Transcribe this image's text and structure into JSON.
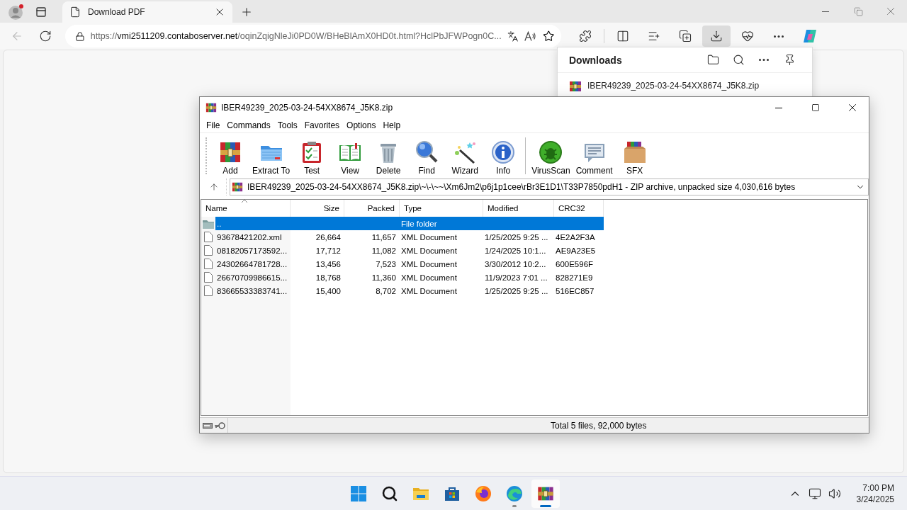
{
  "browser": {
    "tabs": [
      {
        "title": "Download PDF",
        "selected": true
      }
    ],
    "url": {
      "scheme": "https://",
      "host": "vmi2511209.contaboserver.net",
      "rest": "/oqinZqigNleJi0PD0W/BHeBlAmX0HD0t.html?HclPbJFWPogn0C..."
    },
    "back_disabled": true,
    "toolbar_buttons": [
      {
        "kind": "extensions",
        "active": false
      },
      {
        "kind": "split",
        "active": false
      },
      {
        "kind": "favorites",
        "active": false
      },
      {
        "kind": "collections",
        "active": false
      },
      {
        "kind": "downloads",
        "active": true
      },
      {
        "kind": "essentials",
        "active": false
      },
      {
        "kind": "more",
        "active": false
      },
      {
        "kind": "copilot",
        "active": false
      }
    ]
  },
  "downloads": {
    "title": "Downloads",
    "items": [
      {
        "name": "IBER49239_2025-03-24-54XX8674_J5K8.zip"
      }
    ]
  },
  "winrar": {
    "title": "IBER49239_2025-03-24-54XX8674_J5K8.zip",
    "menu": [
      "File",
      "Commands",
      "Tools",
      "Favorites",
      "Options",
      "Help"
    ],
    "toolbar_groups": [
      {
        "buttons": [
          {
            "kind": "add",
            "label": "Add"
          },
          {
            "kind": "extract",
            "label": "Extract To"
          },
          {
            "kind": "test",
            "label": "Test"
          },
          {
            "kind": "view",
            "label": "View"
          },
          {
            "kind": "delete",
            "label": "Delete"
          },
          {
            "kind": "find",
            "label": "Find"
          },
          {
            "kind": "wizard",
            "label": "Wizard"
          },
          {
            "kind": "info",
            "label": "Info"
          }
        ]
      },
      {
        "buttons": [
          {
            "kind": "virusscan",
            "label": "VirusScan"
          },
          {
            "kind": "comment",
            "label": "Comment"
          },
          {
            "kind": "sfx",
            "label": "SFX"
          }
        ]
      }
    ],
    "path": "IBER49239_2025-03-24-54XX8674_J5K8.zip\\~\\-\\~~\\Xm6Jm2\\p6j1p1cee\\rBr3E1D1\\T33P7850pdH1 - ZIP archive, unpacked size 4,030,616 bytes",
    "columns": [
      {
        "label": "Name",
        "sorted": true
      },
      {
        "label": "Size",
        "sorted": false
      },
      {
        "label": "Packed",
        "sorted": false
      },
      {
        "label": "Type",
        "sorted": false
      },
      {
        "label": "Modified",
        "sorted": false
      },
      {
        "label": "CRC32",
        "sorted": false
      }
    ],
    "rows": [
      {
        "kind": "folder",
        "selected": true,
        "cells": [
          "..",
          "",
          "",
          "File folder",
          "",
          ""
        ]
      },
      {
        "kind": "file",
        "selected": false,
        "cells": [
          "93678421202.xml",
          "26,664",
          "11,657",
          "XML Document",
          "1/25/2025 9:25 ...",
          "4E2A2F3A"
        ]
      },
      {
        "kind": "file",
        "selected": false,
        "cells": [
          "08182057173592...",
          "17,712",
          "11,082",
          "XML Document",
          "1/24/2025 10:1...",
          "AE9A23E5"
        ]
      },
      {
        "kind": "file",
        "selected": false,
        "cells": [
          "24302664781728...",
          "13,456",
          "7,523",
          "XML Document",
          "3/30/2012 10:2...",
          "600E596F"
        ]
      },
      {
        "kind": "file",
        "selected": false,
        "cells": [
          "26670709986615...",
          "18,768",
          "11,360",
          "XML Document",
          "11/9/2023 7:01 ...",
          "828271E9"
        ]
      },
      {
        "kind": "file",
        "selected": false,
        "cells": [
          "83665533383741...",
          "15,400",
          "8,702",
          "XML Document",
          "1/25/2025 9:25 ...",
          "516EC857"
        ]
      }
    ],
    "status": "Total 5 files, 92,000 bytes"
  },
  "taskbar": {
    "apps": [
      {
        "kind": "start",
        "active": false,
        "running": false
      },
      {
        "kind": "search",
        "active": false,
        "running": false
      },
      {
        "kind": "explorer",
        "active": false,
        "running": false
      },
      {
        "kind": "store",
        "active": false,
        "running": false
      },
      {
        "kind": "firefox",
        "active": false,
        "running": false
      },
      {
        "kind": "edge",
        "active": false,
        "running": true
      },
      {
        "kind": "winrar",
        "active": true,
        "running": true
      }
    ],
    "time": "7:00 PM",
    "date": "3/24/2025"
  }
}
